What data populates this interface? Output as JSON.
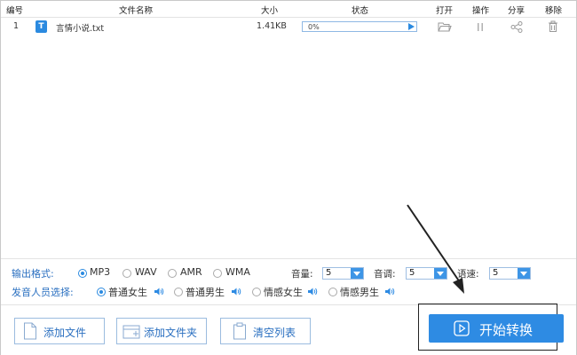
{
  "header": {
    "col_index": "编号",
    "col_name": "文件名称",
    "col_size": "大小",
    "col_status": "状态",
    "col_open": "打开",
    "col_action": "操作",
    "col_share": "分享",
    "col_remove": "移除"
  },
  "rows": [
    {
      "index": "1",
      "icon": "T",
      "name": "言情小说.txt",
      "size": "1.41KB",
      "progress": "0%",
      "progress_value": 0
    }
  ],
  "options": {
    "format_label": "输出格式:",
    "formats": [
      "MP3",
      "WAV",
      "AMR",
      "WMA"
    ],
    "format_selected": "MP3",
    "volume_label": "音量:",
    "volume_value": "5",
    "pitch_label": "音调:",
    "pitch_value": "5",
    "speed_label": "语速:",
    "speed_value": "5",
    "voice_label": "发音人员选择:",
    "voices": [
      "普通女生",
      "普通男生",
      "情感女生",
      "情感男生"
    ],
    "voice_selected": "普通女生"
  },
  "buttons": {
    "add_file": "添加文件",
    "add_folder": "添加文件夹",
    "clear_list": "清空列表",
    "start": "开始转换"
  },
  "colors": {
    "accent": "#2e8be3",
    "label_blue": "#2a6fc0",
    "annotation": "#222222"
  }
}
